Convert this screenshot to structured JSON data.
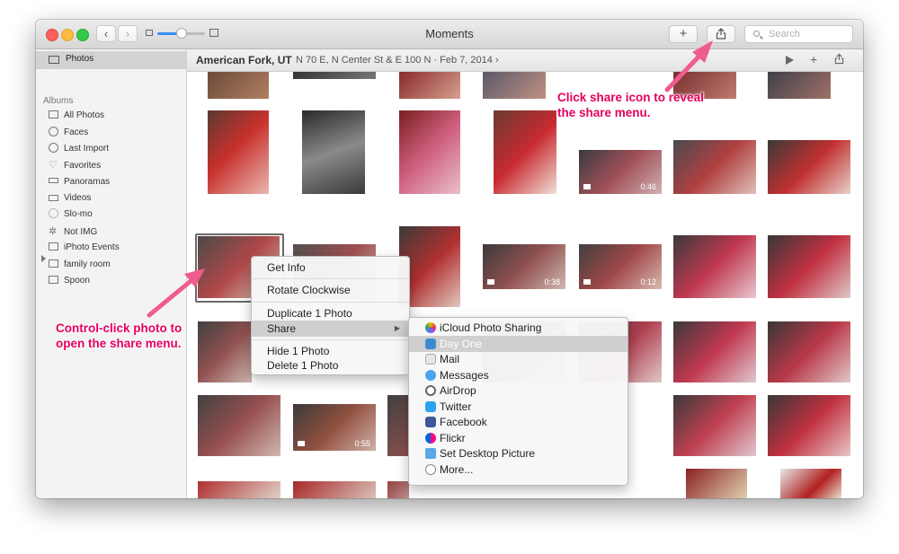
{
  "window": {
    "title": "Moments"
  },
  "toolbar": {
    "back_label": "‹",
    "forward_label": "›",
    "add_label": "+",
    "share_label": "⇪",
    "search_placeholder": "Search",
    "zoom_level": 0.5
  },
  "sidebar": {
    "photos_label": "Photos",
    "albums_header": "Albums",
    "items": [
      {
        "label": "All Photos",
        "icon": "photos-icon"
      },
      {
        "label": "Faces",
        "icon": "face-icon"
      },
      {
        "label": "Last Import",
        "icon": "clock-icon"
      },
      {
        "label": "Favorites",
        "icon": "heart-icon"
      },
      {
        "label": "Panoramas",
        "icon": "panorama-icon"
      },
      {
        "label": "Videos",
        "icon": "video-icon"
      },
      {
        "label": "Slo-mo",
        "icon": "slomo-icon"
      },
      {
        "label": "Not IMG",
        "icon": "gear-icon"
      },
      {
        "label": "iPhoto Events",
        "icon": "folder-icon"
      },
      {
        "label": "family room",
        "icon": "album-icon"
      },
      {
        "label": "Spoon",
        "icon": "album-icon"
      }
    ]
  },
  "pathbar": {
    "location": "American Fork, UT",
    "address": "N 70 E, N Center St & E 100 N  ·  Feb 7, 2014 ›",
    "play_label": "▶",
    "add_label": "+",
    "share_label": "⇪"
  },
  "videos": {
    "d1": "0:46",
    "d2": "0:38",
    "d3": "0:12",
    "d4": "0:55"
  },
  "context_menu": {
    "items": [
      "Get Info",
      "Rotate Clockwise",
      "Duplicate 1 Photo",
      "Share",
      "Hide 1 Photo",
      "Delete 1 Photo"
    ],
    "submenu_arrow": "▶"
  },
  "share_menu": {
    "items": [
      "iCloud Photo Sharing",
      "Day One",
      "Mail",
      "Messages",
      "AirDrop",
      "Twitter",
      "Facebook",
      "Flickr",
      "Set Desktop Picture",
      "More..."
    ]
  },
  "annotations": {
    "share_icon_line1": "Click share icon to reveal",
    "share_icon_line2": "the share menu.",
    "control_click_line1": "Control-click photo to",
    "control_click_line2": "open the share menu."
  },
  "colors": {
    "annotation": "#e5005c",
    "accent": "#3c8ef5"
  }
}
